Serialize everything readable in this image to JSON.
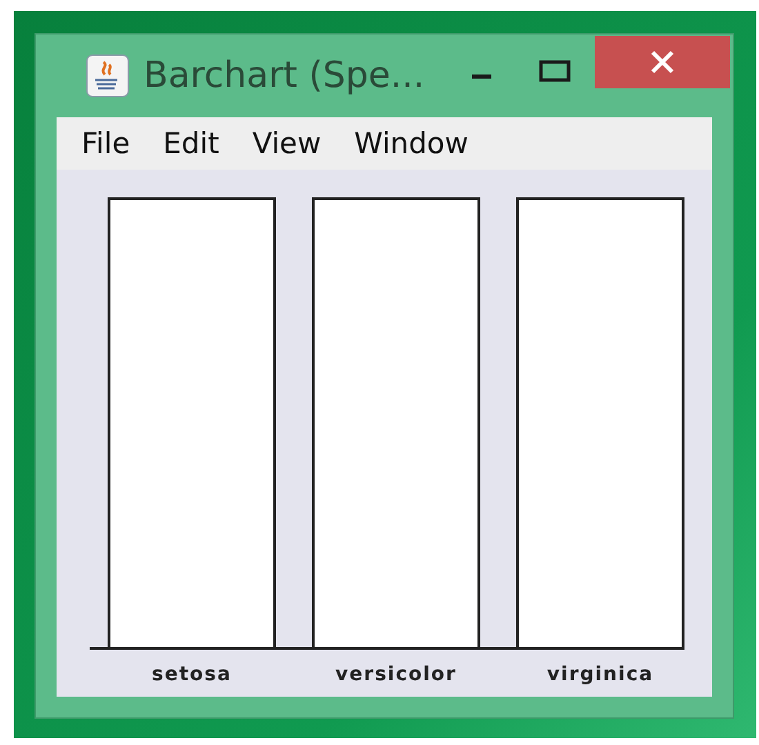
{
  "window": {
    "title": "Barchart (Spe..."
  },
  "menu": [
    "File",
    "Edit",
    "View",
    "Window"
  ],
  "chart": {
    "categories": [
      "setosa",
      "versicolor",
      "virginica"
    ]
  }
}
